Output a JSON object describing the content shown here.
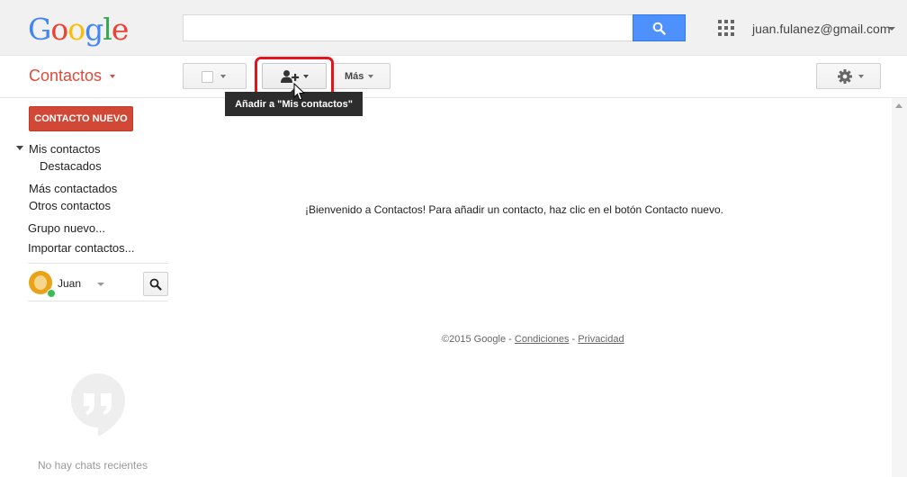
{
  "header": {
    "logo_letters": [
      {
        "ch": "G",
        "color": "#4285f4"
      },
      {
        "ch": "o",
        "color": "#ea4335"
      },
      {
        "ch": "o",
        "color": "#fbbc05"
      },
      {
        "ch": "g",
        "color": "#4285f4"
      },
      {
        "ch": "l",
        "color": "#34a853"
      },
      {
        "ch": "e",
        "color": "#ea4335"
      }
    ],
    "search_placeholder": "",
    "account_email": "juan.fulanez@gmail.com"
  },
  "toolbar": {
    "app_title": "Contactos",
    "more_label": "Más",
    "tooltip": "Añadir a \"Mis contactos\""
  },
  "sidebar": {
    "new_contact_label": "CONTACTO NUEVO",
    "nav": {
      "my_contacts": "Mis contactos",
      "starred": "Destacados",
      "most_contacted": "Más contactados",
      "other_contacts": "Otros contactos",
      "new_group": "Grupo nuevo...",
      "import": "Importar contactos..."
    },
    "chat": {
      "user_name": "Juan",
      "no_recent": "No hay chats recientes"
    }
  },
  "main": {
    "welcome": "¡Bienvenido a Contactos! Para añadir un contacto, haz clic en el botón Contacto nuevo.",
    "footer": {
      "copyright": "©2015 Google",
      "separator": "-",
      "terms": "Condiciones",
      "privacy": "Privacidad"
    }
  },
  "colors": {
    "accent_red": "#dd4b39",
    "button_red": "#d14836",
    "search_blue": "#4d90fe",
    "highlight_red": "#e5141a",
    "online_green": "#3cba54"
  },
  "icons": [
    "search-icon",
    "apps-grid-icon",
    "add-person-icon",
    "gear-icon",
    "hangouts-icon",
    "mouse-cursor-icon"
  ]
}
